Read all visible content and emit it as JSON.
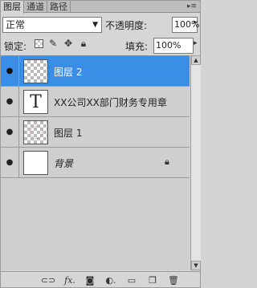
{
  "tabs": [
    {
      "label": "图层",
      "active": true
    },
    {
      "label": "通道",
      "active": false
    },
    {
      "label": "路径",
      "active": false
    }
  ],
  "blend_mode": "正常",
  "opacity": {
    "label": "不透明度:",
    "value": "100%"
  },
  "lock": {
    "label": "锁定:"
  },
  "fill": {
    "label": "填充:",
    "value": "100%"
  },
  "layers": [
    {
      "name": "图层 2",
      "selected": true,
      "thumb": "transparent"
    },
    {
      "name": "XX公司XX部门财务专用章",
      "selected": false,
      "thumb": "text",
      "thumb_glyph": "T"
    },
    {
      "name": "图层 1",
      "selected": false,
      "thumb": "stamp"
    },
    {
      "name": "背景",
      "selected": false,
      "thumb": "white",
      "locked": true
    }
  ],
  "bottom_icons": [
    "link-icon",
    "fx-icon",
    "mask-icon",
    "adjustment-icon",
    "group-icon",
    "new-layer-icon",
    "trash-icon"
  ],
  "colors": {
    "selection": "#3b8ee6",
    "panel": "#d6d6d6"
  }
}
